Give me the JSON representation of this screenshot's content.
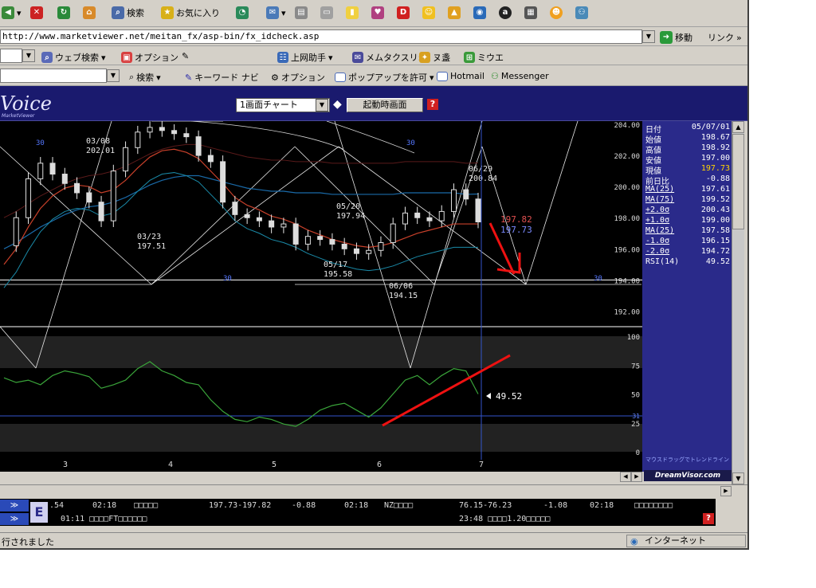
{
  "toolbar1": {
    "search_label": "検索",
    "favorites_label": "お気に入り"
  },
  "address": {
    "url": "http://www.marketviewer.net/meitan_fx/asp-bin/fx_idcheck.asp",
    "go_label": "移動",
    "links_label": "リンク"
  },
  "toolbar2": {
    "web_search_label": "ウェブ検索",
    "options_label": "オプション",
    "jouou_label": "上网助手",
    "mail_label": "メムタクスリ:0",
    "item_a": "ヌ盞",
    "item_b": "ミウエ"
  },
  "toolbar3": {
    "search_label": "検索",
    "keyword_nav_label": "キーワード ナビ",
    "options_label": "オプション",
    "popup_label": "ポップアップを許可",
    "hotmail_label": "Hotmail",
    "messenger_label": "Messenger"
  },
  "app": {
    "logo_text": "Voice",
    "logo_sub": "MarketViewer",
    "chart_select": "1画面チャート",
    "startup_button": "起動時画面",
    "help_icon": "?",
    "brand": "DreamVisor.com",
    "hint": "マウスドラッグでトレンドライン"
  },
  "chart_data": {
    "type": "line",
    "price_axis": [
      "204.00",
      "202.00",
      "200.00",
      "198.00",
      "196.00",
      "194.00",
      "192.00"
    ],
    "rsi_axis": [
      "100",
      "75",
      "50",
      "25",
      "0"
    ],
    "x_ticks": [
      "3",
      "4",
      "5",
      "6",
      "7"
    ],
    "rsi_marker_30": "31",
    "cycle_labels": [
      "30",
      "30",
      "30",
      "30"
    ],
    "annotations": [
      {
        "date": "03/08",
        "price": "202.01"
      },
      {
        "date": "03/23",
        "price": "197.51"
      },
      {
        "date": "05/20",
        "price": "197.94"
      },
      {
        "date": "05/17",
        "price": "195.58"
      },
      {
        "date": "06/06",
        "price": "194.15"
      },
      {
        "date": "06/29",
        "price": "200.84"
      }
    ],
    "price_tag_1": "197.82",
    "price_tag_2": "197.73",
    "rsi_tag": "49.52",
    "rsi_values": [
      64,
      60,
      62,
      58,
      66,
      70,
      68,
      65,
      55,
      58,
      62,
      72,
      78,
      70,
      66,
      60,
      58,
      45,
      35,
      28,
      26,
      30,
      28,
      24,
      22,
      28,
      36,
      40,
      42,
      36,
      30,
      38,
      50,
      62,
      66,
      58,
      66,
      72,
      70,
      50
    ],
    "close_values": [
      196.2,
      198.0,
      200.5,
      201.5,
      200.8,
      200.2,
      199.6,
      199.0,
      197.8,
      201.0,
      202.5,
      203.5,
      203.8,
      203.6,
      203.4,
      203.2,
      202.0,
      201.6,
      199.0,
      198.2,
      198.0,
      197.8,
      197.4,
      197.6,
      196.3,
      196.8,
      196.6,
      196.3,
      196.0,
      195.7,
      195.9,
      196.4,
      197.6,
      198.3,
      198.0,
      197.8,
      198.4,
      199.8,
      199.2,
      197.73
    ],
    "ma_short": [
      195.0,
      196.0,
      197.4,
      198.6,
      199.4,
      199.9,
      200.1,
      200.0,
      199.6,
      199.8,
      200.4,
      201.2,
      201.9,
      202.3,
      202.4,
      202.2,
      201.8,
      201.0,
      200.2,
      199.3,
      198.8,
      198.5,
      198.1,
      197.9,
      197.6,
      197.2,
      196.9,
      196.6,
      196.4,
      196.2,
      196.1,
      196.2,
      196.4,
      196.7,
      197.0,
      197.2,
      197.4,
      197.6,
      197.6,
      197.6
    ],
    "ma_long": [
      196.0,
      196.4,
      196.9,
      197.4,
      197.8,
      198.2,
      198.5,
      198.7,
      198.8,
      199.0,
      199.3,
      199.7,
      200.1,
      200.4,
      200.6,
      200.7,
      200.7,
      200.5,
      200.3,
      200.1,
      199.9,
      199.8,
      199.7,
      199.7,
      199.6,
      199.6,
      199.6,
      199.5,
      199.5,
      199.5,
      199.5,
      199.5,
      199.5,
      199.6,
      199.6,
      199.6,
      199.6,
      199.6,
      199.5,
      199.52
    ]
  },
  "sidebar": {
    "rows": [
      {
        "k": "日付",
        "v": "05/07/01"
      },
      {
        "k": "始値",
        "v": "198.67"
      },
      {
        "k": "高値",
        "v": "198.92"
      },
      {
        "k": "安値",
        "v": "197.00"
      },
      {
        "k": "現値",
        "v": "197.73"
      },
      {
        "k": "前日比",
        "v": "-0.88"
      },
      {
        "k": "MA(25)",
        "v": "197.61"
      },
      {
        "k": "MA(75)",
        "v": "199.52"
      },
      {
        "k": "+2.0σ",
        "v": "200.43"
      },
      {
        "k": "+1.0σ",
        "v": "199.00"
      },
      {
        "k": "MA(25)",
        "v": "197.58"
      },
      {
        "k": "-1.0σ",
        "v": "196.15"
      },
      {
        "k": "-2.0σ",
        "v": "194.72"
      },
      {
        "k": "RSI(14)",
        "v": "49.52"
      }
    ]
  },
  "ticker": {
    "r1": [
      ".54",
      "02:18",
      "□□□□□",
      "197.73-197.82",
      "-0.88",
      "02:18",
      "NZ□□□□",
      "76.15-76.23",
      "-1.08",
      "02:18",
      "□□□□□□□□"
    ],
    "r2a": "01:11 □□□□FT□□□□□□",
    "r2b": "23:48 □□□□1.20□□□□□",
    "btn": "≫"
  },
  "status": {
    "left": "行されました",
    "zone": "インターネット"
  },
  "colors": {
    "panel": "#d4d0c8",
    "chart_bg": "#000000",
    "side_bg": "#2a2a8a",
    "red_line": "#ee1111",
    "blue_line": "#2255cc",
    "green_rsi": "#3aa53a"
  }
}
